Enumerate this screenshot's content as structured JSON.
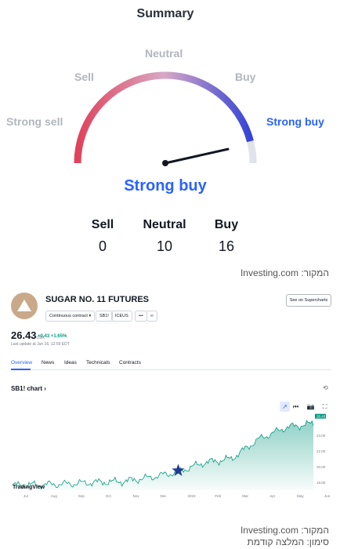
{
  "summary": {
    "title": "Summary",
    "labels": {
      "strong_sell": "Strong sell",
      "sell": "Sell",
      "neutral": "Neutral",
      "buy": "Buy",
      "strong_buy": "Strong buy"
    },
    "result": "Strong buy",
    "counts": [
      {
        "label": "Sell",
        "value": "0"
      },
      {
        "label": "Neutral",
        "value": "10"
      },
      {
        "label": "Buy",
        "value": "16"
      }
    ],
    "gauge_level": 0.93,
    "colors": {
      "sell": "#e0425b",
      "buy": "#3544d6",
      "active": "#2962ff"
    }
  },
  "source1": "המקור: Investing.com",
  "widget": {
    "logo_icon": "triangle-logo-icon",
    "title": "SUGAR NO. 11 FUTURES",
    "pills": [
      "Continuous contract ▾",
      "SB1!",
      "ICEUS",
      "•••",
      "∞"
    ],
    "super_button": "See on Supercharts",
    "price": "26.43",
    "price_unit": "USX",
    "change": "+0.43  +1.65%",
    "last_update": "Last update at Jun 16, 12:59 EDT",
    "tabs": [
      "Overview",
      "News",
      "Ideas",
      "Technicals",
      "Contracts"
    ],
    "active_tab": 0,
    "chart_title": "SB1! chart ›",
    "tools": [
      "↗",
      "⏮",
      "📷",
      "⛶"
    ],
    "tv_logo": "TradingView",
    "accent": "#2962ff",
    "green": "#089981"
  },
  "chart_data": {
    "type": "area",
    "x": [
      "Jul",
      "Aug",
      "Sep",
      "Oct",
      "Nov",
      "Dec",
      "2023",
      "Feb",
      "Mar",
      "Apr",
      "May",
      "Jun"
    ],
    "values": [
      17.6,
      17.7,
      17.8,
      18.0,
      18.1,
      18.6,
      19.3,
      20.5,
      21.0,
      23.5,
      25.0,
      25.5
    ],
    "ylim": [
      17.0,
      26.5
    ],
    "y_ticks": [
      "26.43",
      "24.00",
      "22.00",
      "20.00",
      "18.00"
    ],
    "marker_date": "2023"
  },
  "source2": "המקור: Investing.com",
  "footnote": "סימון: המלצה קודמת"
}
